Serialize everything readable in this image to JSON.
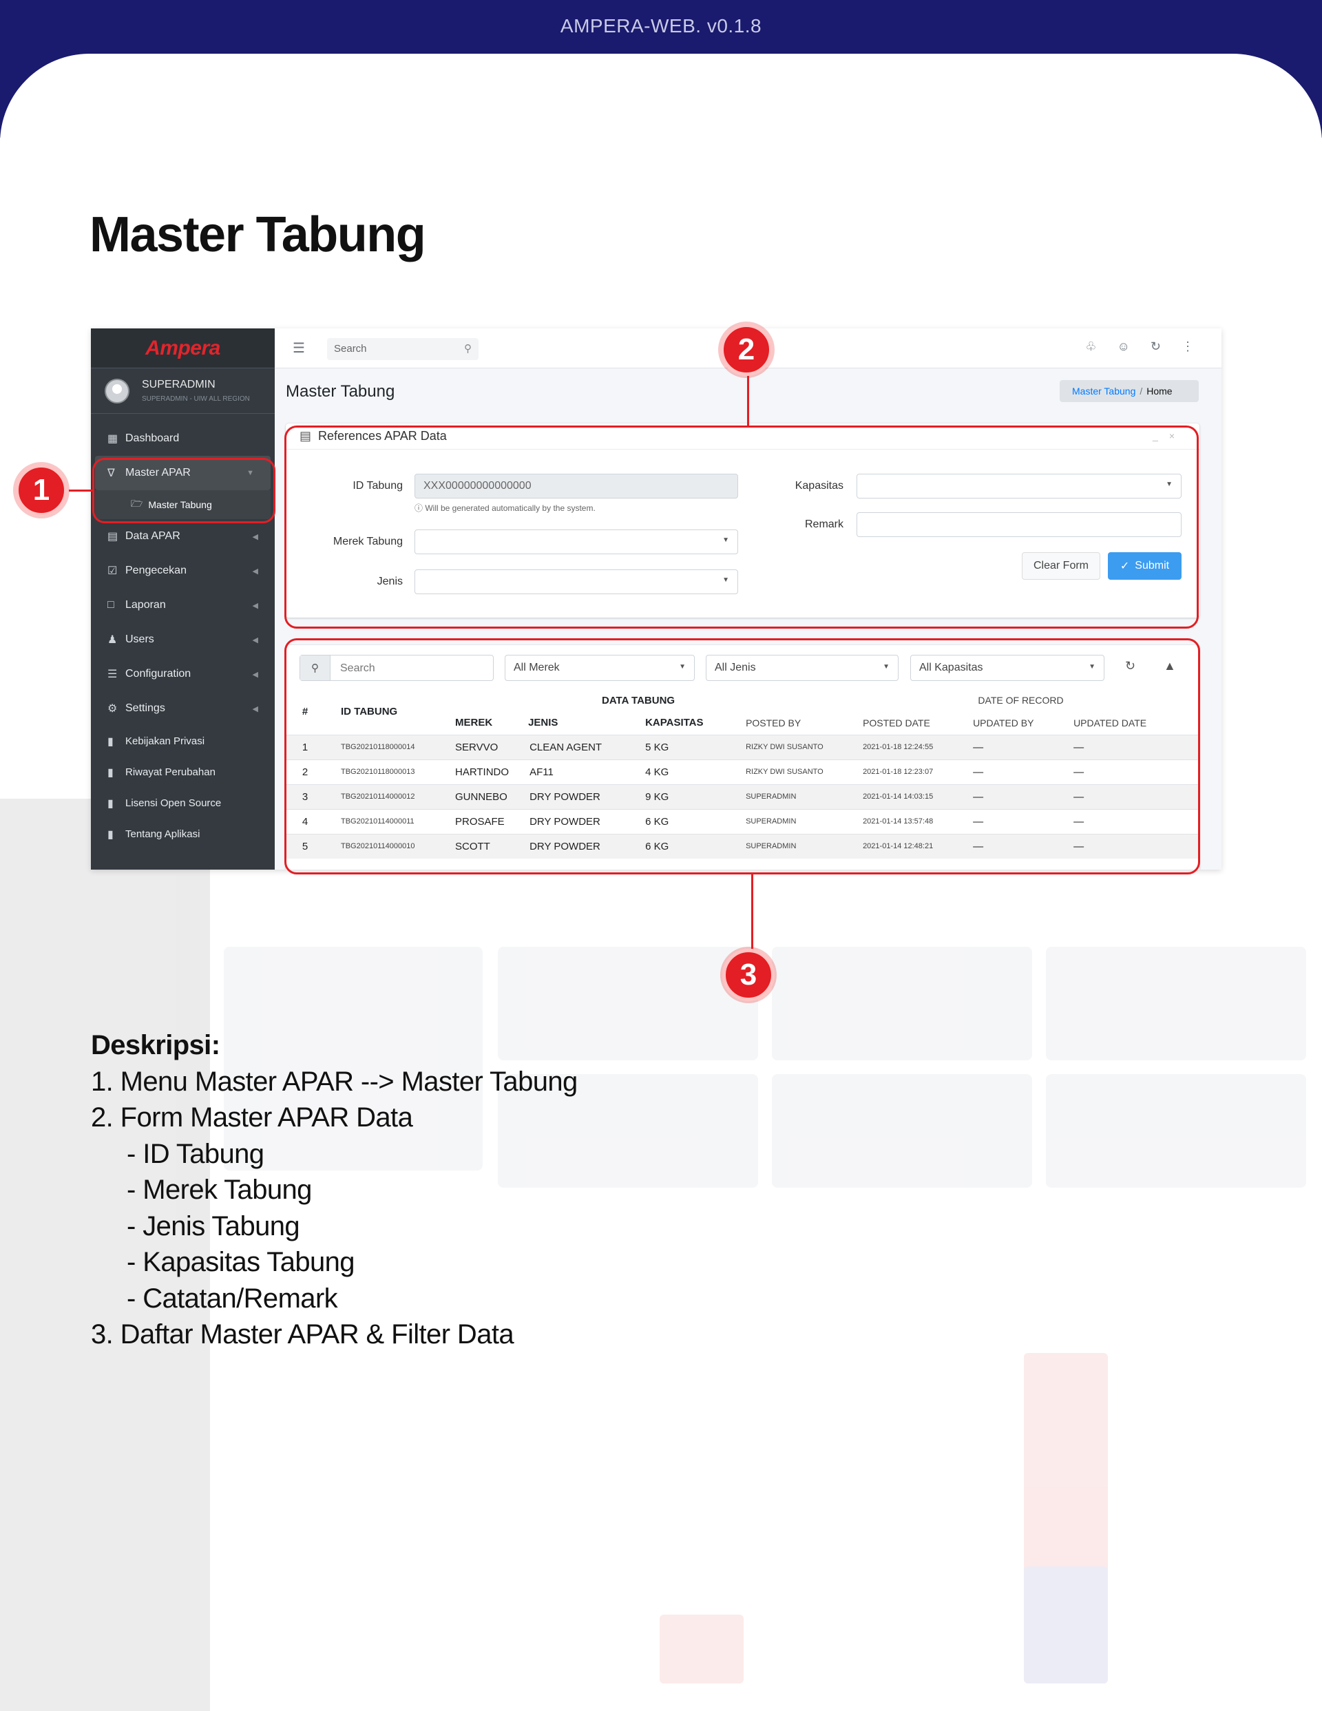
{
  "banner": {
    "title": "AMPERA-WEB. v0.1.8"
  },
  "page_title": "Master Tabung",
  "app": {
    "logo": "Ampera",
    "user": {
      "name": "SUPERADMIN",
      "role": "SUPERADMIN - UIW ALL REGION"
    },
    "sidebar": {
      "items": [
        {
          "label": "Dashboard",
          "icon": "bar-chart-icon"
        },
        {
          "label": "Master APAR",
          "icon": "area-chart-icon",
          "active": true
        },
        {
          "label": "Master Tabung",
          "icon": "folder-open-icon",
          "sub": true
        },
        {
          "label": "Data APAR",
          "icon": "clipboard-icon"
        },
        {
          "label": "Pengecekan",
          "icon": "calendar-check-icon"
        },
        {
          "label": "Laporan",
          "icon": "file-icon"
        },
        {
          "label": "Users",
          "icon": "users-icon"
        },
        {
          "label": "Configuration",
          "icon": "sliders-icon"
        },
        {
          "label": "Settings",
          "icon": "gear-icon"
        },
        {
          "label": "Kebijakan Privasi",
          "icon": "document-icon"
        },
        {
          "label": "Riwayat Perubahan",
          "icon": "document-icon"
        },
        {
          "label": "Lisensi Open Source",
          "icon": "document-icon"
        },
        {
          "label": "Tentang Aplikasi",
          "icon": "document-icon"
        }
      ]
    },
    "topbar": {
      "search_placeholder": "Search",
      "icons": [
        "bell-icon",
        "user-icon",
        "refresh-icon",
        "more-vertical-icon"
      ]
    },
    "content_title": "Master Tabung",
    "breadcrumb": {
      "link": "Master Tabung",
      "separator": "/",
      "current": "Home"
    },
    "form": {
      "title": "References APAR Data",
      "id_label": "ID Tabung",
      "id_value": "XXX00000000000000",
      "id_hint": "Will be generated automatically by the system.",
      "merek_label": "Merek Tabung",
      "jenis_label": "Jenis",
      "kapasitas_label": "Kapasitas",
      "remark_label": "Remark",
      "clear_label": "Clear Form",
      "submit_label": "Submit"
    },
    "table": {
      "search_placeholder": "Search",
      "filters": [
        "All Merek",
        "All Jenis",
        "All Kapasitas"
      ],
      "group_headers": {
        "data": "DATA TABUNG",
        "date": "DATE OF RECORD"
      },
      "columns": [
        "#",
        "ID TABUNG",
        "MEREK",
        "JENIS",
        "KAPASITAS",
        "POSTED BY",
        "POSTED DATE",
        "UPDATED BY",
        "UPDATED DATE"
      ],
      "rows": [
        [
          "1",
          "TBG20210118000014",
          "SERVVO",
          "CLEAN AGENT",
          "5 KG",
          "RIZKY DWI SUSANTO",
          "2021-01-18 12:24:55",
          "—",
          "—"
        ],
        [
          "2",
          "TBG20210118000013",
          "HARTINDO",
          "AF11",
          "4 KG",
          "RIZKY DWI SUSANTO",
          "2021-01-18 12:23:07",
          "—",
          "—"
        ],
        [
          "3",
          "TBG20210114000012",
          "GUNNEBO",
          "DRY POWDER",
          "9 KG",
          "SUPERADMIN",
          "2021-01-14 14:03:15",
          "—",
          "—"
        ],
        [
          "4",
          "TBG20210114000011",
          "PROSAFE",
          "DRY POWDER",
          "6 KG",
          "SUPERADMIN",
          "2021-01-14 13:57:48",
          "—",
          "—"
        ],
        [
          "5",
          "TBG20210114000010",
          "SCOTT",
          "DRY POWDER",
          "6 KG",
          "SUPERADMIN",
          "2021-01-14 12:48:21",
          "—",
          "—"
        ]
      ]
    }
  },
  "callouts": [
    "1",
    "2",
    "3"
  ],
  "description": {
    "heading": "Deskripsi:",
    "lines": [
      "1.  Menu Master APAR  --> Master Tabung",
      "2. Form Master  APAR Data",
      "- ID Tabung",
      "- Merek Tabung",
      "- Jenis Tabung",
      "- Kapasitas Tabung",
      "- Catatan/Remark",
      "3. Daftar Master APAR & Filter Data"
    ]
  },
  "colors": {
    "banner": "#1a1a6e",
    "accent_red": "#e31e24",
    "sidebar": "#343a40",
    "primary_blue": "#3c9cf0"
  }
}
